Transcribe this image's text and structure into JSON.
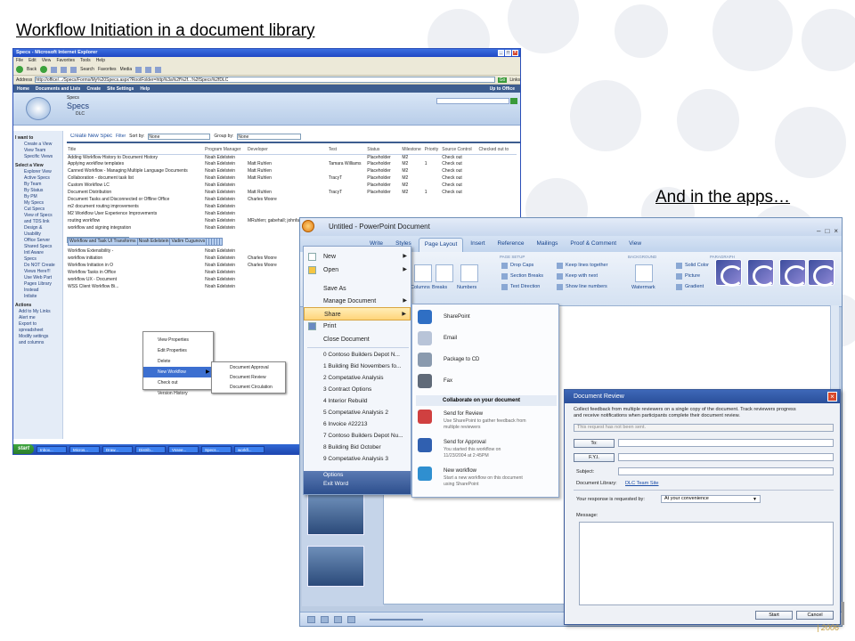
{
  "slide": {
    "title": "Workflow Initiation in a document library",
    "apps_caption": "And in the apps…",
    "year": "| 2006"
  },
  "ie": {
    "title": "Specs - Microsoft Internet Explorer",
    "menu": [
      "File",
      "Edit",
      "View",
      "Favorites",
      "Tools",
      "Help"
    ],
    "toolbar": [
      "Back",
      "Search",
      "Favorites",
      "Media"
    ],
    "address_label": "Address",
    "address": "http://office/.../Specs/Forms/My%20Specs.aspx?RootFolder=http%3a%2f%2f...%2fSpecs%2fDLC",
    "go": "Go",
    "links": "Links"
  },
  "sp": {
    "topnav": [
      "Home",
      "Documents and Lists",
      "Create",
      "Site Settings",
      "Help"
    ],
    "up_to": "Up to Office",
    "breadcrumb": "Specs",
    "site_title": "Specs",
    "folder": "DLC",
    "left_nav": [
      {
        "kind": "h",
        "text": "I want to"
      },
      {
        "kind": "i",
        "text": "Create a View"
      },
      {
        "kind": "i",
        "text": "View Team"
      },
      {
        "kind": "i",
        "text": "Specific Views"
      },
      {
        "kind": "h",
        "text": "Select a View"
      },
      {
        "kind": "i",
        "text": "Explorer View"
      },
      {
        "kind": "i",
        "text": "Active Specs"
      },
      {
        "kind": "i",
        "text": "By Team"
      },
      {
        "kind": "i",
        "text": "By Status"
      },
      {
        "kind": "i",
        "text": "By PM"
      },
      {
        "kind": "i",
        "text": "My Specs"
      },
      {
        "kind": "i",
        "text": "Cut Specs"
      },
      {
        "kind": "i",
        "text": "View of Specs"
      },
      {
        "kind": "i",
        "text": "and TDS link"
      },
      {
        "kind": "i",
        "text": "Design &"
      },
      {
        "kind": "i",
        "text": "Usability"
      },
      {
        "kind": "i",
        "text": "Office Server"
      },
      {
        "kind": "i",
        "text": "Shared Specs"
      },
      {
        "kind": "i",
        "text": "Intl Aware"
      },
      {
        "kind": "i",
        "text": "Specs"
      },
      {
        "kind": "i",
        "text": "Do NOT Create"
      },
      {
        "kind": "i",
        "text": "Views Here!!!"
      },
      {
        "kind": "i",
        "text": "Use Web Part"
      },
      {
        "kind": "i",
        "text": "Pages Library"
      },
      {
        "kind": "i",
        "text": "Instead"
      },
      {
        "kind": "i",
        "text": "Intlsite"
      },
      {
        "kind": "h",
        "text": "Actions"
      },
      {
        "kind": "a",
        "text": "Add to My Links"
      },
      {
        "kind": "a",
        "text": "Alert me"
      },
      {
        "kind": "a",
        "text": "Export to"
      },
      {
        "kind": "a",
        "text": "spreadsheet"
      },
      {
        "kind": "a",
        "text": "Modify settings"
      },
      {
        "kind": "a",
        "text": "and columns"
      }
    ],
    "toolbar": {
      "new": "Create New Spec",
      "filter": "Filter",
      "sort": "Sort by:",
      "sort_val": "None",
      "group": "Group by:",
      "group_val": "None"
    },
    "columns": [
      "Title",
      "Program Manager",
      "Developer",
      "Test",
      "Status",
      "Milestone",
      "Priority",
      "Source Control",
      "Checked out to"
    ],
    "rows": [
      [
        "Adding Workflow History to Document History",
        "Noah Edelstein",
        "",
        "",
        "Placeholder",
        "M2",
        "",
        "Check out",
        ""
      ],
      [
        "Applying workflow templates",
        "Noah Edelstein",
        "Matt Ruhlen",
        "Tamara Williams",
        "Placeholder",
        "M2",
        "1",
        "Check out",
        ""
      ],
      [
        "Canned Workflow - Managing Multiple Language Documents",
        "Noah Edelstein",
        "Matt Ruhlen",
        "",
        "Placeholder",
        "M2",
        "",
        "Check out",
        ""
      ],
      [
        "Collaboration - document task list",
        "Noah Edelstein",
        "Matt Ruhlen",
        "TracyT",
        "Placeholder",
        "M2",
        "",
        "Check out",
        ""
      ],
      [
        "Custom Workflow LC",
        "Noah Edelstein",
        "",
        "",
        "Placeholder",
        "M2",
        "",
        "Check out",
        ""
      ],
      [
        "Document Distribution",
        "Noah Edelstein",
        "Matt Ruhlen",
        "TracyT",
        "Placeholder",
        "M2",
        "1",
        "Check out",
        ""
      ],
      [
        "Document Tasks and Disconnected or Offline Office",
        "Noah Edelstein",
        "Charles Moore",
        "",
        "",
        "",
        "",
        "",
        ""
      ],
      [
        "m2 document routing improvements",
        "Noah Edelstein",
        "",
        "",
        "",
        "",
        "",
        "",
        ""
      ],
      [
        "M2 Workflow User Experience Improvements",
        "Noah Edelstein",
        "",
        "",
        "",
        "",
        "",
        "",
        ""
      ],
      [
        "routing workflow",
        "Noah Edelstein",
        "MRuhlen; gabehall; johnfan;cgmoore",
        "",
        "",
        "",
        "",
        "",
        ""
      ],
      [
        "workflow and signing integration",
        "Noah Edelstein",
        "",
        "",
        "",
        "",
        "",
        "",
        ""
      ],
      [
        "Workflow and Task UI Transforms",
        "Noah Edelstein",
        "Vadim Cugunovs",
        "",
        "",
        "",
        "",
        "",
        ""
      ],
      [
        "Workflow Extensibility -",
        "Noah Edelstein",
        "",
        "",
        "",
        "",
        "",
        "",
        ""
      ],
      [
        "workflow initiation",
        "Noah Edelstein",
        "Charles Moore",
        "",
        "",
        "",
        "",
        "",
        ""
      ],
      [
        "Workflow Initiation in O",
        "Noah Edelstein",
        "Charles Moore",
        "",
        "",
        "",
        "",
        "",
        ""
      ],
      [
        "Workflow Tasks in Office",
        "Noah Edelstein",
        "",
        "",
        "",
        "",
        "",
        "",
        ""
      ],
      [
        "workflow UX - Document",
        "Noah Edelstein",
        "",
        "",
        "",
        "",
        "",
        "",
        ""
      ],
      [
        "WSS Client Workflow Bi...",
        "Noah Edelstein",
        "",
        "",
        "",
        "",
        "",
        "",
        ""
      ]
    ],
    "ctx_menu": [
      "View Properties",
      "Edit Properties",
      "Delete",
      "New Workflow",
      "Check out",
      "Version History"
    ],
    "ctx_sub": [
      "Document Approval",
      "Document Review",
      "Document Circulation"
    ]
  },
  "taskbar": {
    "start": "start",
    "items": [
      "Inbox...",
      "Micros...",
      "Draw...",
      "Distrib...",
      "Vssee...",
      "Specs...",
      "workfl..."
    ]
  },
  "ppt": {
    "title": "Untitled - PowerPoint Document",
    "tabs": [
      "Write",
      "Styles",
      "Page Layout",
      "Insert",
      "Reference",
      "Mailings",
      "Proof & Comment",
      "View"
    ],
    "active_tab": "Page Layout",
    "ribbon": {
      "group_page_setup": "PAGE SETUP",
      "group_background": "BACKGROUND",
      "group_paragraph": "PARAGRAPH",
      "big": [
        "Columns",
        "Breaks",
        "Numbers",
        "Watermark"
      ],
      "small": [
        "Drop Caps",
        "Section Breaks",
        "Text Direction",
        "Keep lines together",
        "Keep with next",
        "Show line numbers",
        "Solid Color",
        "Picture",
        "Gradient"
      ]
    },
    "office_menu": [
      "New",
      "Open",
      "Save As",
      "Manage Document",
      "Share",
      "Print",
      "Close Document"
    ],
    "recent": [
      "0 Contoso Builders Depot N...",
      "1 Building Bid Novembers fo...",
      "2 Competative Analysis",
      "3 Contract Options",
      "4 Interior Rebuild",
      "5 Competative Analysis 2",
      "6 Invoice #22213",
      "7 Contoso Builders Depot Nu...",
      "8 Building Bid October",
      "9 Competative Analysis 3"
    ],
    "menu_footer": [
      "Options",
      "Exit Word"
    ],
    "share": {
      "items": [
        "SharePoint",
        "Email",
        "Package to CD",
        "Fax"
      ],
      "section": "Collaborate on your document",
      "collab": [
        {
          "title": "Send for Review",
          "desc": [
            "Use SharePoint to gather feedback from",
            "multiple reviewers"
          ]
        },
        {
          "title": "Send for Approval",
          "desc": [
            "You started this workflow on",
            "11/23/2004 at 2:45PM"
          ]
        },
        {
          "title": "New workflow",
          "desc": [
            "Start a new workflow on this document",
            "using SharePoint"
          ]
        }
      ]
    }
  },
  "dialog": {
    "title": "Document Review",
    "intro": [
      "Collect feedback from multiple reviewers on a single copy of the document. Track reviewers progress",
      "and receive notifications when participants complete their document review."
    ],
    "status": "This request has not been sent.",
    "to_btn": "To:",
    "fyi_btn": "F.Y.I.",
    "subject_label": "Subject:",
    "library_label": "Document Library:",
    "library": "DLC Team Site",
    "response_label": "Your response is requested by:",
    "response": "At your convenience",
    "message_label": "Message:",
    "start": "Start",
    "cancel": "Cancel"
  }
}
